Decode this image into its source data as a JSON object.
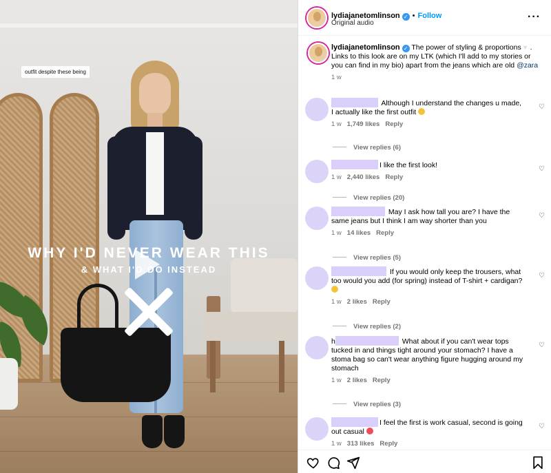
{
  "video": {
    "overlay_caption": "outfit despite these being",
    "title_main": "WHY I'D NEVER WEAR THIS",
    "title_sub": "& WHAT I'D DO INSTEAD"
  },
  "header": {
    "username": "lydiajanetomlinson",
    "follow_label": "Follow",
    "subtitle": "Original audio",
    "separator": "•"
  },
  "post_caption": {
    "username": "lydiajanetomlinson",
    "text_a": "The power of styling & proportions",
    "text_b": ". Links to this look are on my LTK (which I'll add to my stories or you can find in my bio) apart from the jeans which are old",
    "mention": "@zara",
    "time": "1 w"
  },
  "comments": [
    {
      "text": "Although I understand the changes u made, I actually like the first outfit",
      "time": "1 w",
      "likes": "1,749 likes",
      "reply": "Reply",
      "view_replies": "View replies (6)"
    },
    {
      "text": "I like the first look!",
      "time": "1 w",
      "likes": "2,440 likes",
      "reply": "Reply",
      "view_replies": "View replies (20)"
    },
    {
      "text": "May I ask how tall you are? I have the same jeans but I think I am way shorter than you",
      "time": "1 w",
      "likes": "14 likes",
      "reply": "Reply",
      "view_replies": "View replies (5)"
    },
    {
      "text": "If you would only keep the trousers, what too would you add (for spring) instead of T-shirt + cardigan?",
      "time": "1 w",
      "likes": "2 likes",
      "reply": "Reply",
      "view_replies": "View replies (2)"
    },
    {
      "prefix": "h",
      "text": "What about if you can't wear tops tucked in and things tight around your stomach? I have a stoma bag so can't wear anything figure hugging around my stomach",
      "time": "1 w",
      "likes": "2 likes",
      "reply": "Reply",
      "view_replies": "View replies (3)"
    },
    {
      "text": "I feel the first is work casual, second is going out casual",
      "time": "1 w",
      "likes": "313 likes",
      "reply": "Reply"
    }
  ],
  "icons": {
    "more": "more-options-icon",
    "like": "heart-icon",
    "comment": "comment-icon",
    "share": "share-icon",
    "save": "bookmark-icon"
  },
  "colors": {
    "follow": "#0095f6",
    "verified": "#3897f0",
    "redaction": "#d9cffa",
    "meta": "#737373"
  }
}
